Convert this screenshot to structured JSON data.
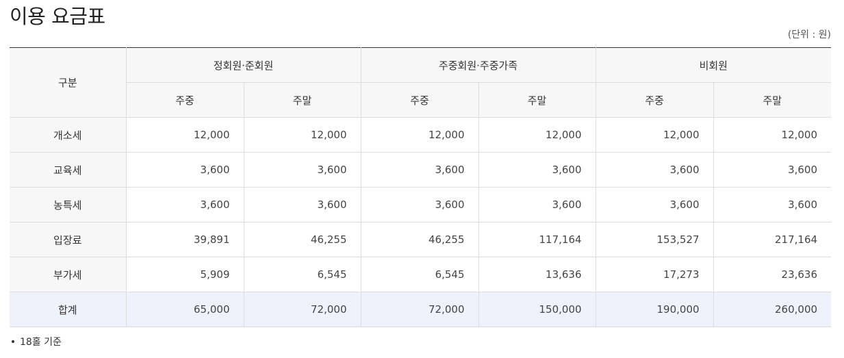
{
  "page": {
    "title": "이용 요금표",
    "unit": "(단위 : 원)"
  },
  "table": {
    "corner": "구분",
    "groups": [
      "정회원·준회원",
      "주중회원·주중가족",
      "비회원"
    ],
    "subheaders": [
      "주중",
      "주말",
      "주중",
      "주말",
      "주중",
      "주말"
    ],
    "rows": [
      {
        "label": "개소세",
        "values": [
          "12,000",
          "12,000",
          "12,000",
          "12,000",
          "12,000",
          "12,000"
        ]
      },
      {
        "label": "교육세",
        "values": [
          "3,600",
          "3,600",
          "3,600",
          "3,600",
          "3,600",
          "3,600"
        ]
      },
      {
        "label": "농특세",
        "values": [
          "3,600",
          "3,600",
          "3,600",
          "3,600",
          "3,600",
          "3,600"
        ]
      },
      {
        "label": "입장료",
        "values": [
          "39,891",
          "46,255",
          "46,255",
          "117,164",
          "153,527",
          "217,164"
        ]
      },
      {
        "label": "부가세",
        "values": [
          "5,909",
          "6,545",
          "6,545",
          "13,636",
          "17,273",
          "23,636"
        ]
      },
      {
        "label": "합계",
        "values": [
          "65,000",
          "72,000",
          "72,000",
          "150,000",
          "190,000",
          "260,000"
        ]
      }
    ]
  },
  "notes": [
    "18홀 기준"
  ]
}
